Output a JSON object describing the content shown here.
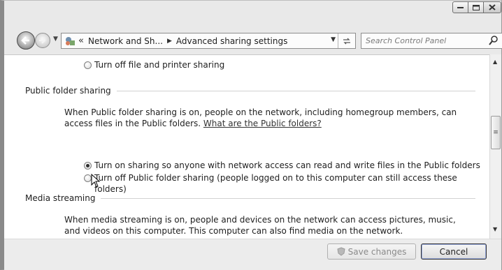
{
  "window": {
    "caption_buttons": [
      "minimize-icon",
      "maximize-icon",
      "close-icon"
    ]
  },
  "navigation": {
    "breadcrumb_prefix": "«",
    "breadcrumbs": [
      "Network and Sh...",
      "Advanced sharing settings"
    ],
    "search_placeholder": "Search Control Panel"
  },
  "content": {
    "file_sharing_option": "Turn off file and printer sharing",
    "public_folder": {
      "header": "Public folder sharing",
      "description": "When Public folder sharing is on, people on the network, including homegroup members, can access files in the Public folders.",
      "link": "What are the Public folders?",
      "options": [
        {
          "label": "Turn on sharing so anyone with network access can read and write files in the Public folders",
          "selected": true
        },
        {
          "label": "Turn off Public folder sharing (people logged on to this computer can still access these folders)",
          "selected": false
        }
      ]
    },
    "media_streaming": {
      "header": "Media streaming",
      "description": "When media streaming is on, people and devices on the network can access pictures, music, and videos on this computer. This computer can also find media on the network."
    }
  },
  "footer": {
    "save_label": "Save changes",
    "cancel_label": "Cancel"
  }
}
